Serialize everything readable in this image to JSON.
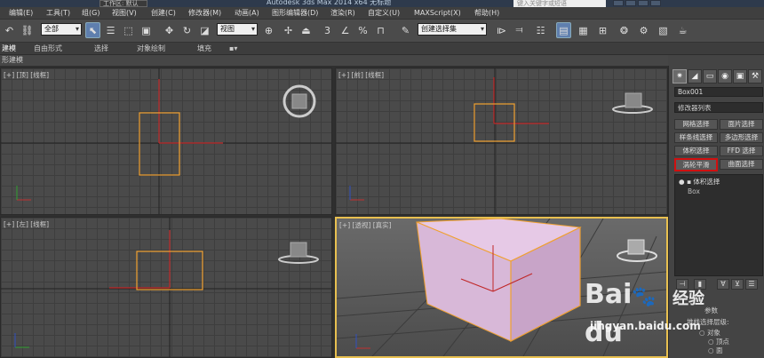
{
  "title_bar": {
    "workspace": "工作区: 默认",
    "window_title": "Autodesk 3ds Max  2014 x64    无标题",
    "search_placeholder": "键入关键字或短语"
  },
  "menu": [
    "编辑(E)",
    "工具(T)",
    "组(G)",
    "视图(V)",
    "创建(C)",
    "修改器(M)",
    "动画(A)",
    "图形编辑器(D)",
    "渲染(R)",
    "自定义(U)",
    "MAXScript(X)",
    "帮助(H)"
  ],
  "toolbar": {
    "selection_filter": "全部",
    "reference_coord": "视图",
    "named_selection": "创建选择集",
    "snap_label": "3",
    "angle_label": "%"
  },
  "ribbon": {
    "tabs": [
      "建模",
      "自由形式",
      "选择",
      "对象绘制",
      "填充",
      "▪▾"
    ],
    "subtitle": "形建模"
  },
  "viewports": {
    "top": "[+] [顶] [线框]",
    "front": "[+] [前] [线框]",
    "left": "[+] [左] [线框]",
    "perspective": "[+] [透视] [真实]"
  },
  "command_panel": {
    "tabs": [
      "✷",
      "◢",
      "▭",
      "◉",
      "▣",
      "⚒"
    ],
    "object_name": "Box001",
    "modifier_list": "修改器列表",
    "modifier_buttons": [
      [
        "网格选择",
        "面片选择"
      ],
      [
        "样条线选择",
        "多边形选择"
      ],
      [
        "体积选择",
        "FFD 选择"
      ],
      [
        "涡轮平滑",
        "曲面选择"
      ]
    ],
    "highlighted_button": "涡轮平滑",
    "stack": {
      "modifier": "体积选择",
      "base": "Box"
    },
    "rollout": {
      "params": "参数",
      "stack_level": "堆栈选择层级:",
      "object": "对象",
      "vertex": "顶点",
      "face": "面"
    }
  },
  "watermark": {
    "brand": "Bai",
    "brand_suffix": "du",
    "cn": "经验",
    "url": "jingyan.baidu.com"
  },
  "colors": {
    "accent": "#5f7fae",
    "object_orange": "#f0a030",
    "box_fill": "#d8b8d8",
    "highlight_red": "#d01010"
  }
}
